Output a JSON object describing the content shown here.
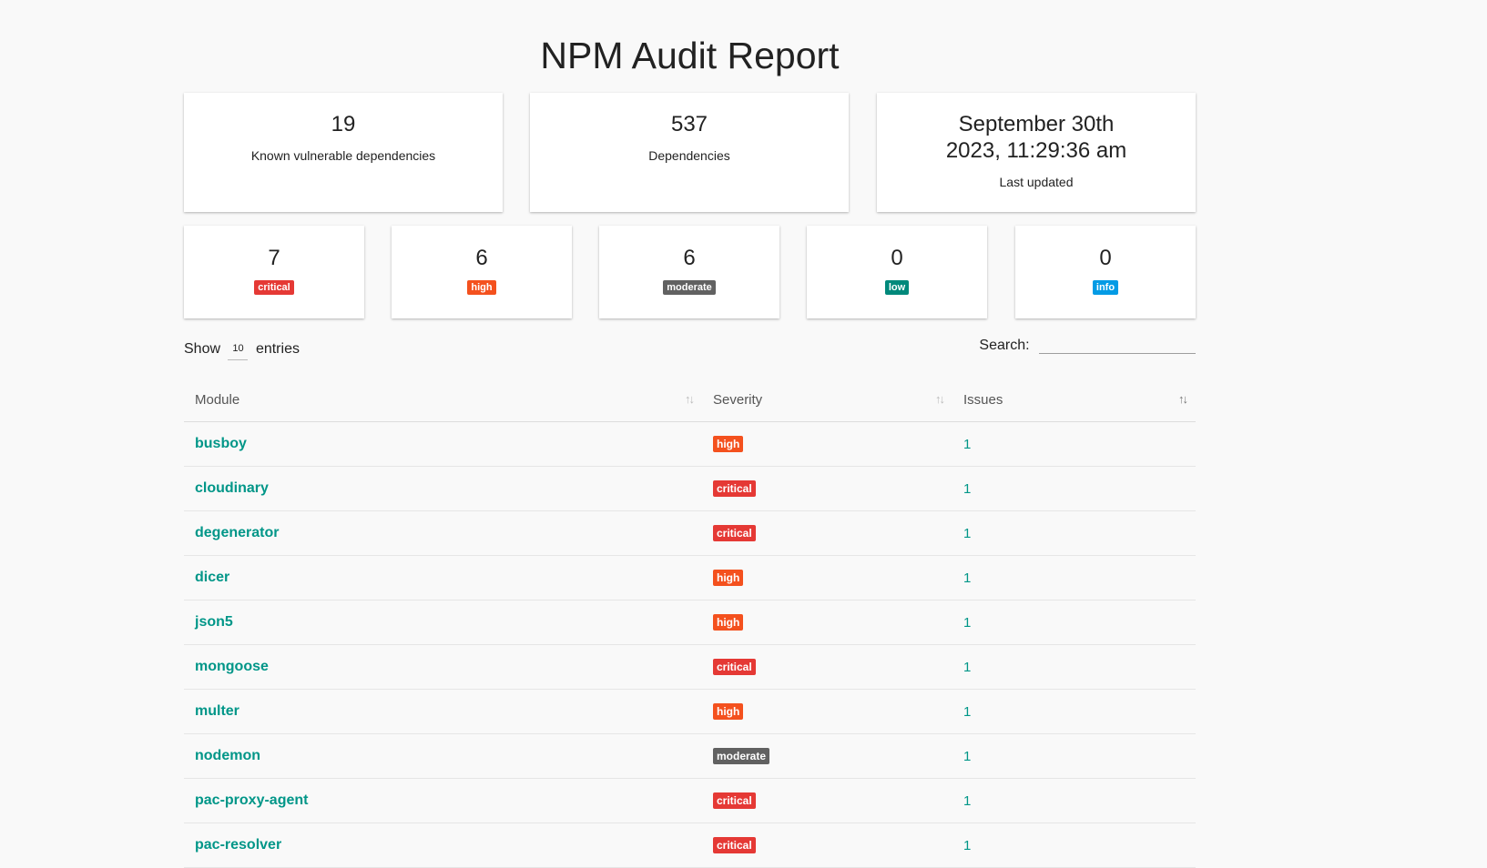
{
  "title": "NPM Audit Report",
  "summary": [
    {
      "value": "19",
      "label": "Known vulnerable dependencies"
    },
    {
      "value": "537",
      "label": "Dependencies"
    },
    {
      "value": "September 30th 2023, 11:29:36 am",
      "label": "Last updated"
    }
  ],
  "severity_counts": [
    {
      "count": "7",
      "label": "critical",
      "color": "#e53935"
    },
    {
      "count": "6",
      "label": "high",
      "color": "#f4511e"
    },
    {
      "count": "6",
      "label": "moderate",
      "color": "#616161"
    },
    {
      "count": "0",
      "label": "low",
      "color": "#00897b"
    },
    {
      "count": "0",
      "label": "info",
      "color": "#039be5"
    }
  ],
  "controls": {
    "show_label": "Show",
    "entries_value": "10",
    "entries_label": "entries",
    "search_label": "Search:",
    "search_value": ""
  },
  "table": {
    "columns": [
      "Module",
      "Severity",
      "Issues"
    ],
    "rows": [
      {
        "module": "busboy",
        "severity": "high",
        "issues": "1"
      },
      {
        "module": "cloudinary",
        "severity": "critical",
        "issues": "1"
      },
      {
        "module": "degenerator",
        "severity": "critical",
        "issues": "1"
      },
      {
        "module": "dicer",
        "severity": "high",
        "issues": "1"
      },
      {
        "module": "json5",
        "severity": "high",
        "issues": "1"
      },
      {
        "module": "mongoose",
        "severity": "critical",
        "issues": "1"
      },
      {
        "module": "multer",
        "severity": "high",
        "issues": "1"
      },
      {
        "module": "nodemon",
        "severity": "moderate",
        "issues": "1"
      },
      {
        "module": "pac-proxy-agent",
        "severity": "critical",
        "issues": "1"
      },
      {
        "module": "pac-resolver",
        "severity": "critical",
        "issues": "1"
      }
    ]
  },
  "icons": {
    "sort": "sort-arrows-icon"
  }
}
